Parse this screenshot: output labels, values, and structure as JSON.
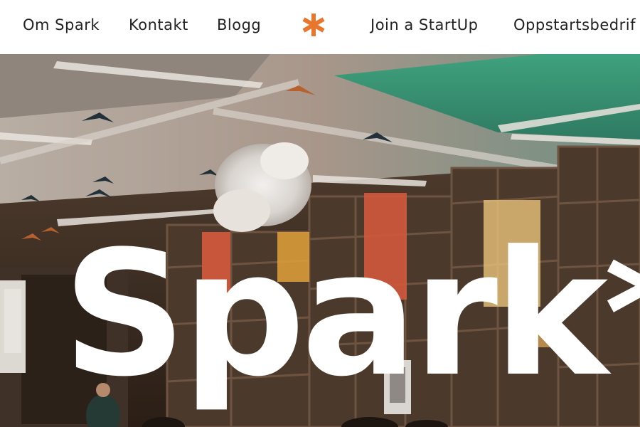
{
  "nav": {
    "items": [
      {
        "label": "Om Spark"
      },
      {
        "label": "Kontakt"
      },
      {
        "label": "Blogg"
      },
      {
        "label": "Join a StartUp"
      },
      {
        "label": "Oppstartsbedrif"
      }
    ],
    "logo_icon": "asterisk-icon"
  },
  "hero": {
    "title": "Spark*"
  },
  "colors": {
    "brand_orange": "#e8762c",
    "nav_text": "#222222",
    "hero_title": "#ffffff"
  }
}
